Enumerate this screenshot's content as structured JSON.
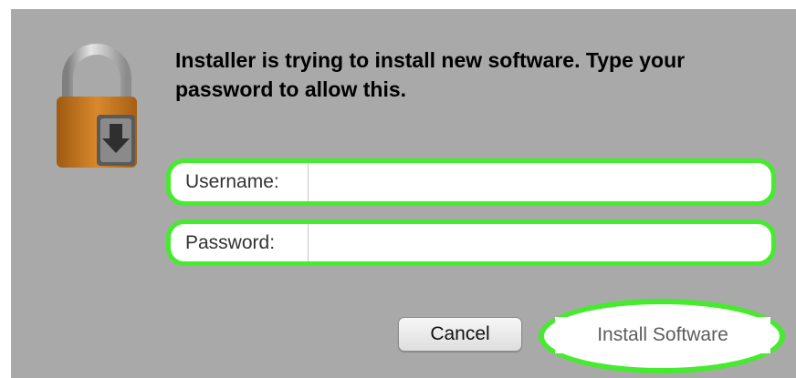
{
  "dialog": {
    "message": "Installer is trying to install new software. Type your password to allow this.",
    "icon": "lock-install-icon"
  },
  "form": {
    "username_label": "Username:",
    "username_value": "",
    "password_label": "Password:",
    "password_value": ""
  },
  "buttons": {
    "cancel_label": "Cancel",
    "install_label": "Install Software"
  },
  "colors": {
    "dialog_background": "#a9a9a9",
    "highlight_outline": "#46ea2e",
    "lock_body": "#c9781c",
    "lock_shackle": "#b5b5b5"
  }
}
